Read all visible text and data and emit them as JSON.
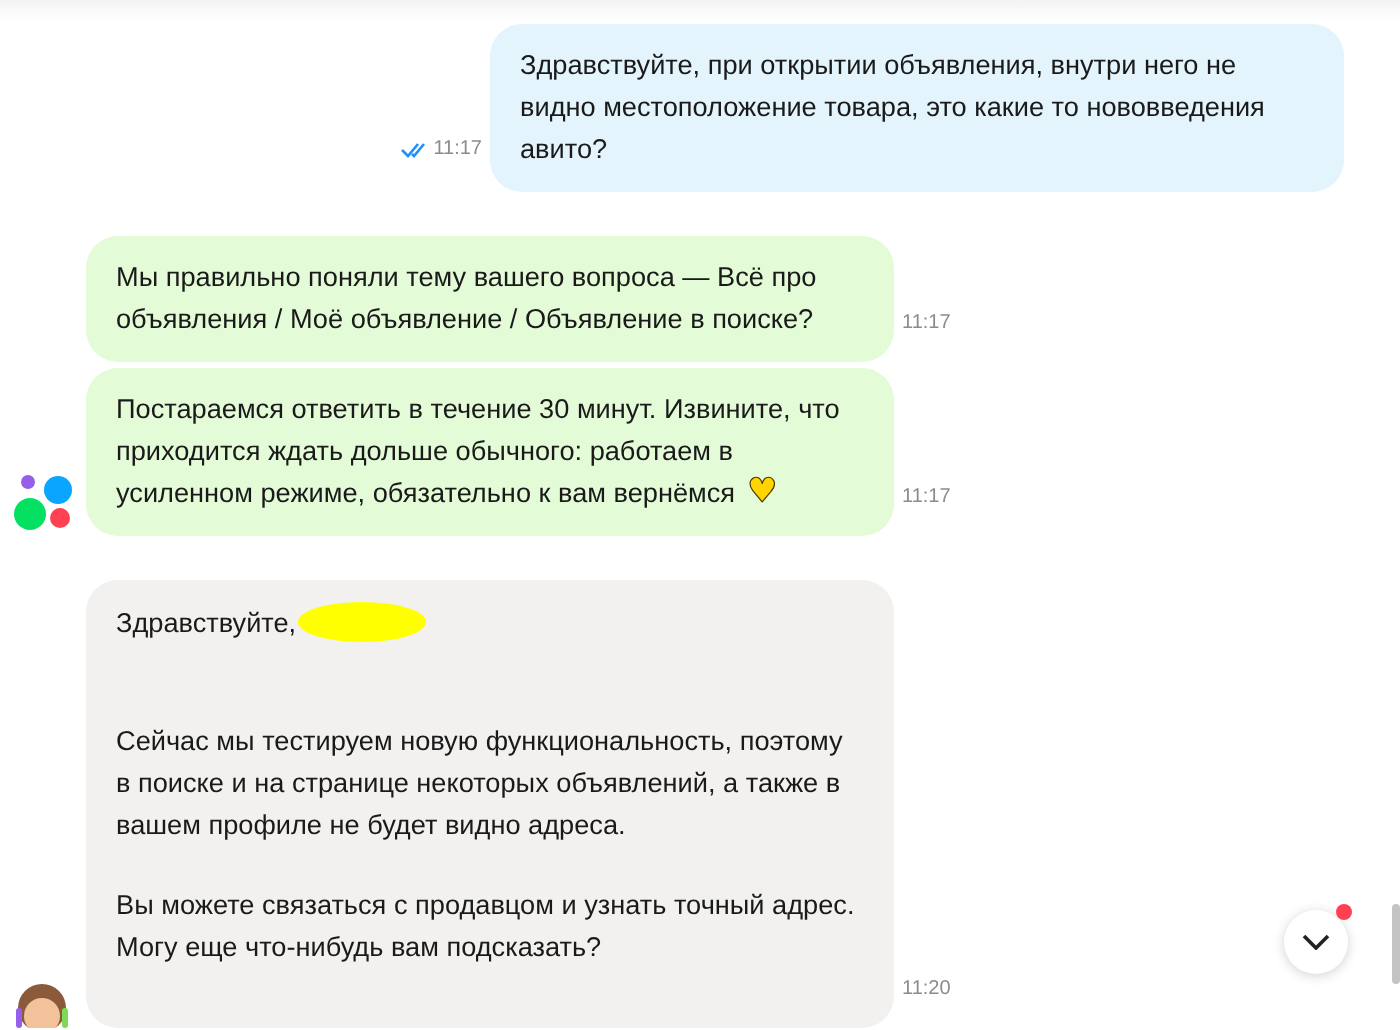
{
  "messages": [
    {
      "kind": "outgoing",
      "paragraphs": [
        "Здравствуйте, при открытии объявления, внутри него не видно местоположение товара, это какие то нововведения авито?"
      ],
      "time": "11:17",
      "read": true
    },
    {
      "kind": "bot",
      "paragraphs": [
        "Мы правильно поняли тему вашего вопроса — Всё про объявления / Моё объявление / Объявление в поиске?"
      ],
      "time": "11:17"
    },
    {
      "kind": "bot",
      "paragraphs": [
        "Постараемся ответить в течение 30 минут. Извините, что приходится ждать дольше обычного: работаем в усиленном режиме, обязательно к вам вернёмся"
      ],
      "emoji": "♥",
      "time": "11:17"
    },
    {
      "kind": "agent",
      "greeting": "Здравствуйте,",
      "redacted_name": true,
      "paragraphs": [
        "Сейчас мы тестируем новую функциональность, поэтому в поиске и на странице некоторых объявлений, а также в вашем профиле не будет видно адреса.",
        "Вы можете связаться с продавцом и узнать точный адрес. Могу еще что-нибудь вам подсказать?"
      ],
      "time": "11:20"
    }
  ],
  "scroll_button": {
    "unread": true
  }
}
